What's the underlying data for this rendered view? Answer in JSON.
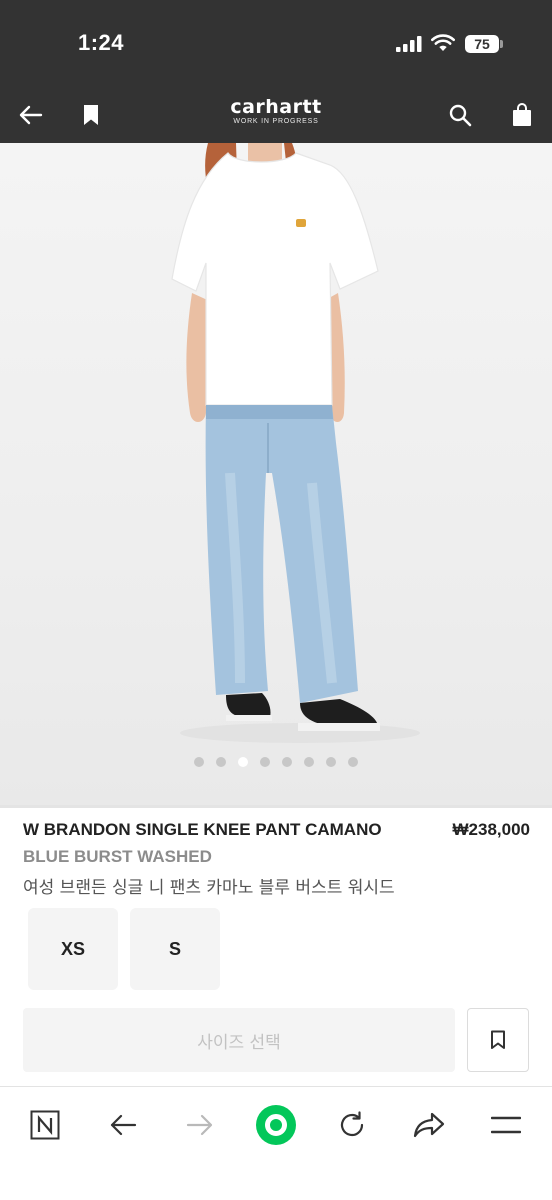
{
  "status_bar": {
    "time": "1:24",
    "battery": "75"
  },
  "header": {
    "brand_name": "carhartt",
    "brand_tagline": "WORK IN PROGRESS",
    "back_icon": "arrow-left-icon",
    "bookmark_icon": "bookmark-icon",
    "search_icon": "search-icon",
    "bag_icon": "shopping-bag-icon"
  },
  "gallery": {
    "total_images": 8,
    "current_index": 3
  },
  "product": {
    "title": "W BRANDON SINGLE KNEE PANT CAMANO",
    "subtitle": "BLUE BURST WASHED",
    "title_korean": "여성 브랜든 싱글 니 팬츠 카마노 블루 버스트 워시드",
    "price": "₩238,000"
  },
  "sizes": [
    {
      "label": "XS"
    },
    {
      "label": "S"
    }
  ],
  "actions": {
    "select_size_label": "사이즈 선택",
    "wishlist_icon": "bookmark-outline-icon"
  },
  "browser_toolbar": {
    "items": [
      "naver-n-icon",
      "back-arrow-icon",
      "forward-arrow-icon",
      "green-dot-home-icon",
      "reload-icon",
      "share-icon",
      "menu-icon"
    ]
  },
  "colors": {
    "header_bg": "#333333",
    "hero_bg": "#efefef",
    "size_chip_bg": "#f4f4f4",
    "naver_green": "#03c75a",
    "subtitle_gray": "#8c8c8c"
  }
}
